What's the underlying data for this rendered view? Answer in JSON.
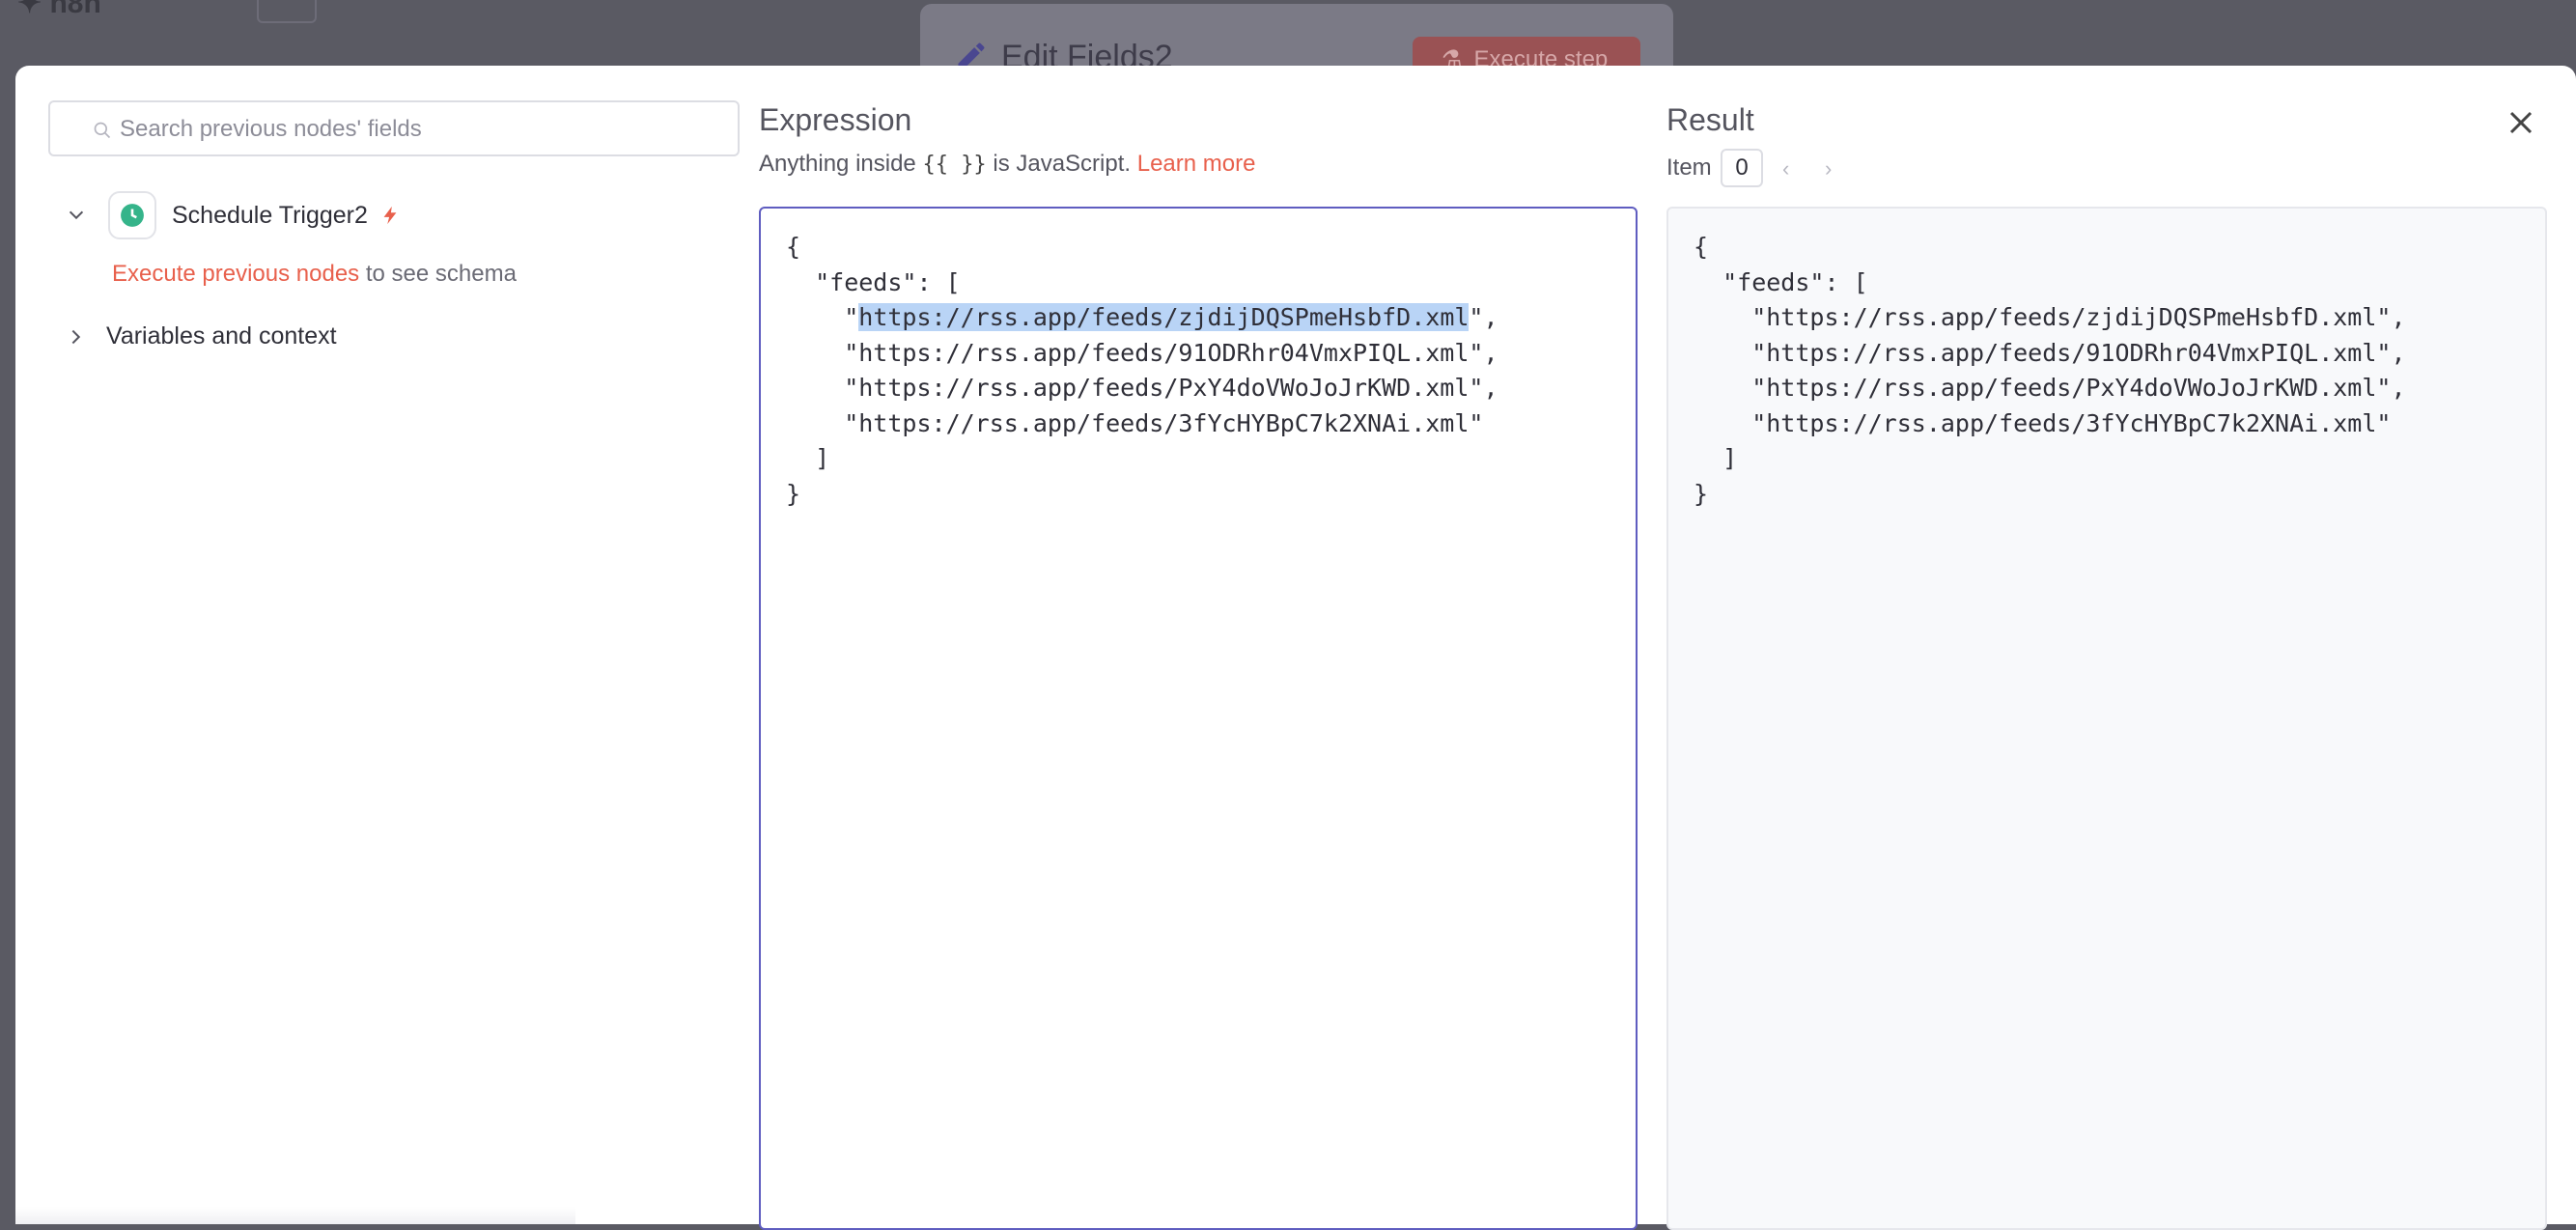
{
  "background": {
    "node_title": "Edit Fields2",
    "execute_button": "Execute step"
  },
  "search": {
    "placeholder": "Search previous nodes' fields"
  },
  "tree": {
    "trigger_node": "Schedule Trigger2",
    "hint_link": "Execute previous nodes",
    "hint_text": " to see schema",
    "variables": "Variables and context"
  },
  "expression": {
    "title": "Expression",
    "subtitle_prefix": "Anything inside ",
    "subtitle_code": "{{ }}",
    "subtitle_suffix": " is JavaScript. ",
    "learn_more": "Learn more",
    "lines": [
      "{",
      "  \"feeds\": [",
      "    \"",
      "    \"https://rss.app/feeds/91ODRhr04VmxPIQL.xml\",",
      "    \"https://rss.app/feeds/PxY4doVWoJoJrKWD.xml\",",
      "    \"https://rss.app/feeds/3fYcHYBpC7k2XNAi.xml\"",
      "  ]",
      "}"
    ],
    "selected_text": "https://rss.app/feeds/zjdijDQSPmeHsbfD.xml",
    "selected_suffix": "\","
  },
  "result": {
    "title": "Result",
    "item_label": "Item",
    "item_value": "0",
    "text": "{\n  \"feeds\": [\n    \"https://rss.app/feeds/zjdijDQSPmeHsbfD.xml\",\n    \"https://rss.app/feeds/91ODRhr04VmxPIQL.xml\",\n    \"https://rss.app/feeds/PxY4doVWoJoJrKWD.xml\",\n    \"https://rss.app/feeds/3fYcHYBpC7k2XNAi.xml\"\n  ]\n}"
  },
  "colors": {
    "accent": "#e8604c",
    "editor_border": "#5f5dc0",
    "selection": "#b9d4f6",
    "trigger_icon": "#35b48a"
  }
}
